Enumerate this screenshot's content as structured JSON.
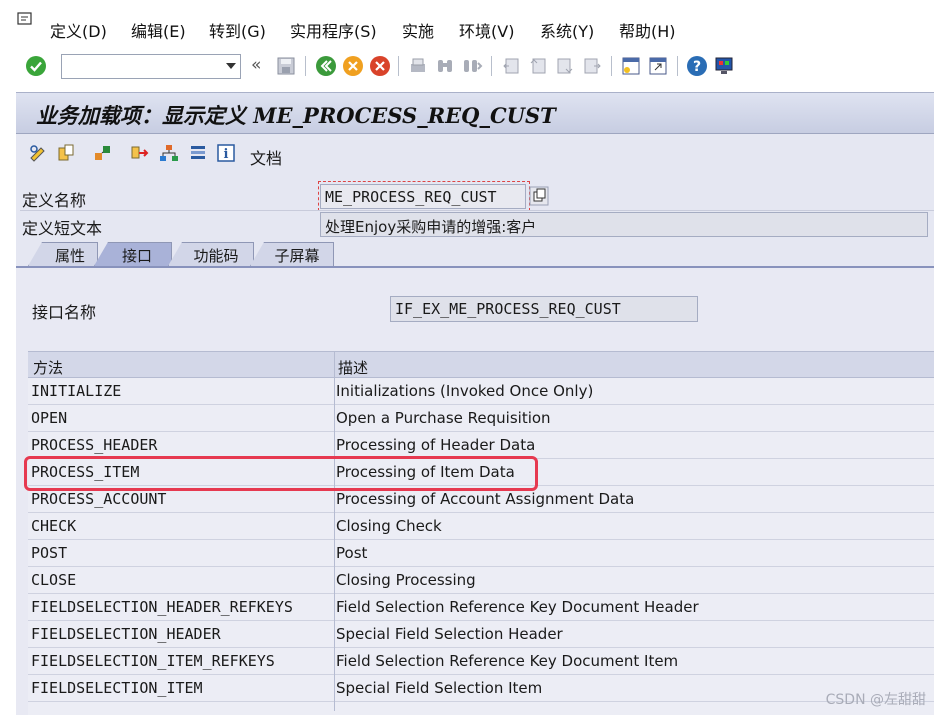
{
  "menu": {
    "items": [
      "定义(D)",
      "编辑(E)",
      "转到(G)",
      "实用程序(S)",
      "实施",
      "环境(V)",
      "系统(Y)",
      "帮助(H)"
    ]
  },
  "toolbar": {
    "command_value": "",
    "icons": [
      "enter-icon",
      "save-icon",
      "back-icon",
      "exit-icon",
      "cancel-icon",
      "print-icon",
      "find-icon",
      "find-next-icon",
      "first-page-icon",
      "prev-page-icon",
      "next-page-icon",
      "last-page-icon",
      "new-session-icon",
      "shortcut-icon",
      "help-icon",
      "layout-icon"
    ]
  },
  "title": "业务加载项：显示定义 ME_PROCESS_REQ_CUST",
  "app_toolbar": {
    "doc_label": "文档"
  },
  "fields": {
    "def_name_label": "定义名称",
    "def_name_value": "ME_PROCESS_REQ_CUST",
    "short_text_label": "定义短文本",
    "short_text_value": "处理Enjoy采购申请的增强:客户"
  },
  "tabs": [
    "属性",
    "接口",
    "功能码",
    "子屏幕"
  ],
  "active_tab": "接口",
  "interface": {
    "label": "接口名称",
    "value": "IF_EX_ME_PROCESS_REQ_CUST"
  },
  "table": {
    "headers": [
      "方法",
      "描述"
    ],
    "rows": [
      {
        "method": "INITIALIZE",
        "desc": "Initializations (Invoked Once Only)"
      },
      {
        "method": "OPEN",
        "desc": "Open a Purchase Requisition"
      },
      {
        "method": "PROCESS_HEADER",
        "desc": "Processing of Header Data"
      },
      {
        "method": "PROCESS_ITEM",
        "desc": "Processing of Item Data"
      },
      {
        "method": "PROCESS_ACCOUNT",
        "desc": "Processing of Account Assignment Data"
      },
      {
        "method": "CHECK",
        "desc": "Closing Check"
      },
      {
        "method": "POST",
        "desc": "Post"
      },
      {
        "method": "CLOSE",
        "desc": "Closing Processing"
      },
      {
        "method": "FIELDSELECTION_HEADER_REFKEYS",
        "desc": "Field Selection Reference Key Document Header"
      },
      {
        "method": "FIELDSELECTION_HEADER",
        "desc": "Special Field Selection Header"
      },
      {
        "method": "FIELDSELECTION_ITEM_REFKEYS",
        "desc": "Field Selection Reference Key Document Item"
      },
      {
        "method": "FIELDSELECTION_ITEM",
        "desc": "Special Field Selection Item"
      },
      {
        "method": "",
        "desc": ""
      }
    ],
    "highlight_row": 3
  },
  "watermark": "CSDN @左甜甜",
  "colors": {
    "highlight": "#e63950",
    "title_bg": "#c7cde2",
    "panel_bg": "#e8e9f3"
  }
}
